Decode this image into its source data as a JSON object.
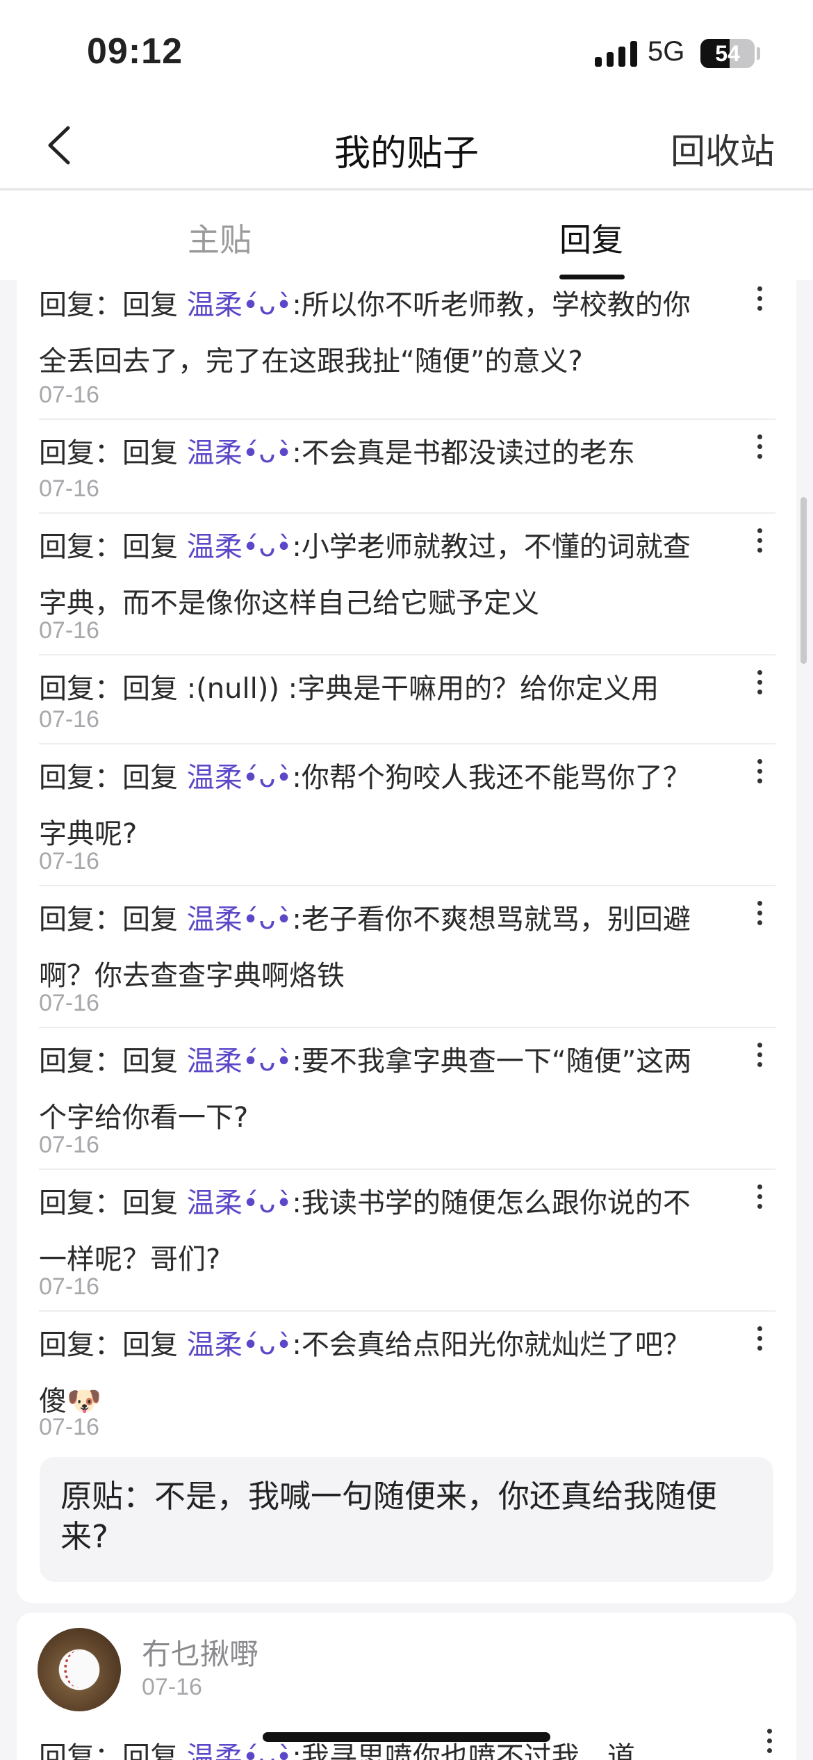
{
  "status_bar": {
    "time": "09:12",
    "network": "5G",
    "battery_percent": "54",
    "battery_level": 0.54
  },
  "nav": {
    "back_icon": "chevron-left-icon",
    "title": "我的贴子",
    "recycle_label": "回收站"
  },
  "tabs": [
    {
      "label": "主贴",
      "active": false
    },
    {
      "label": "回复",
      "active": true
    }
  ],
  "replies": [
    {
      "prefix": "回复：回复 ",
      "user": "温柔•́ᴗ•̀",
      "text": ":所以你不听老师教，学校教的你全丢回去了，完了在这跟我扯“随便”的意义?",
      "date": "07-16"
    },
    {
      "prefix": "回复：回复 ",
      "user": "温柔•́ᴗ•̀",
      "text": ":不会真是书都没读过的老东",
      "date": "07-16"
    },
    {
      "prefix": "回复：回复 ",
      "user": "温柔•́ᴗ•̀",
      "text": ":小学老师就教过，不懂的词就查字典，而不是像你这样自己给它赋予定义",
      "date": "07-16"
    },
    {
      "prefix": "回复：回复 ",
      "user": "",
      "text": ":(null)) :字典是干嘛用的？给你定义用",
      "date": "07-16"
    },
    {
      "prefix": "回复：回复 ",
      "user": "温柔•́ᴗ•̀",
      "text": ":你帮个狗咬人我还不能骂你了？字典呢?",
      "date": "07-16"
    },
    {
      "prefix": "回复：回复 ",
      "user": "温柔•́ᴗ•̀",
      "text": ":老子看你不爽想骂就骂，别回避啊？你去查查字典啊烙铁",
      "date": "07-16"
    },
    {
      "prefix": "回复：回复 ",
      "user": "温柔•́ᴗ•̀",
      "text": ":要不我拿字典查一下“随便”这两个字给你看一下?",
      "date": "07-16"
    },
    {
      "prefix": "回复：回复 ",
      "user": "温柔•́ᴗ•̀",
      "text": ":我读书学的随便怎么跟你说的不一样呢？哥们?",
      "date": "07-16"
    },
    {
      "prefix": "回复：回复 ",
      "user": "温柔•́ᴗ•̀",
      "text": ":不会真给点阳光你就灿烂了吧？傻🐶",
      "date": "07-16"
    }
  ],
  "original_post": "原贴：不是，我喊一句随便来，你还真给我随便来?",
  "next_card": {
    "username": "冇乜揪嘢",
    "date": "07-16",
    "reply_prefix": "回复：回复 ",
    "reply_user": "温柔•́ᴗ•̀",
    "reply_text": ":我寻思喷你也喷不过我，道"
  }
}
